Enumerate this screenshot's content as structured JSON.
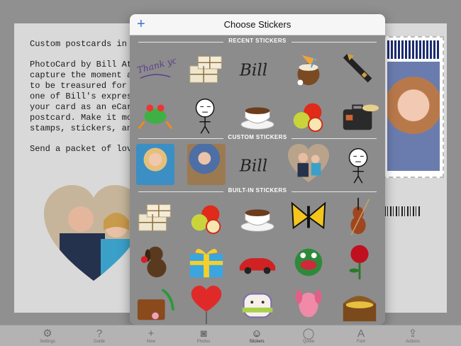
{
  "card": {
    "paragraphs": [
      "Custom postcards in a di",
      "PhotoCard by Bill Atkins\ncapture the moment and\nto be treasured for years\none of Bill's expressive n\nyour card as an eCard or\npostcard. Make it more p\nstamps, stickers, and sig",
      "Send a packet of love tod"
    ]
  },
  "popover": {
    "add_label": "+",
    "title": "Choose Stickers",
    "sections": {
      "recent": "RECENT STICKERS",
      "custom": "CUSTOM STICKERS",
      "builtin": "BUILT-IN STICKERS"
    },
    "recent_stickers": [
      "thank-you-script",
      "gift-packages",
      "bill-signature",
      "coconut-drink",
      "fountain-pen",
      "tree-frog",
      "stick-figure-face",
      "coffee-cup",
      "apples",
      "suitcase-hat"
    ],
    "custom_stickers": [
      "woman-photo",
      "man-dog-photo",
      "bill-signature",
      "couple-heart-photo",
      "stick-figure-face"
    ],
    "builtin_stickers": [
      "gift-packages",
      "apples",
      "coffee-cup",
      "butterfly",
      "violin",
      "dog-rose",
      "gift-box",
      "red-car",
      "green-monster",
      "red-rose",
      "travel-suitcase",
      "heart-balloon",
      "cat-scarf",
      "pink-dog",
      "treasure-chest"
    ]
  },
  "stickers": {
    "bill_text": "Bill",
    "thank_you_text": "Thank you!"
  },
  "toolbar": {
    "items": [
      {
        "label": "Settings",
        "icon": "gear-icon"
      },
      {
        "label": "Guide",
        "icon": "question-icon"
      },
      {
        "label": "New",
        "icon": "plus-icon"
      },
      {
        "label": "Photos",
        "icon": "camera-icon"
      },
      {
        "label": "Stickers",
        "icon": "smiley-icon"
      },
      {
        "label": "Quote",
        "icon": "speech-bubble-icon"
      },
      {
        "label": "Font",
        "icon": "font-icon"
      },
      {
        "label": "Actions",
        "icon": "share-icon"
      }
    ],
    "icons": [
      "⚙",
      "?",
      "+",
      "◙",
      "☺",
      "◯",
      "A",
      "⇪"
    ]
  },
  "colors": {
    "accent": "#3a6fd8",
    "popover_bg": "#8c8c8c",
    "card_bg": "#d9d9d9"
  }
}
